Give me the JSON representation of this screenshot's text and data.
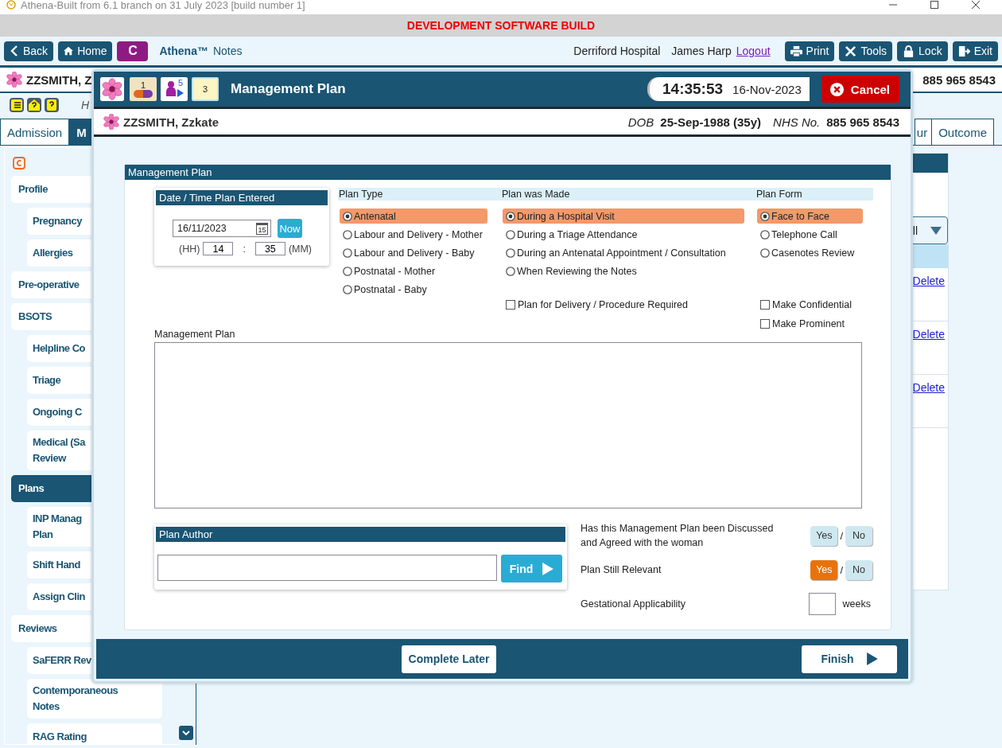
{
  "title_bar": {
    "title": "Athena-Built from 6.1 branch on 31 July 2023 [build number 1]"
  },
  "banner": "DEVELOPMENT SOFTWARE BUILD",
  "toolbar": {
    "left_buttons": [
      {
        "label": "Back"
      },
      {
        "label": "Home"
      }
    ],
    "c_button": "C",
    "app_name": "Athena™",
    "app_suffix": "Notes",
    "hospital": "Derriford Hospital",
    "user": "James Harp",
    "logout": "Logout",
    "right_buttons": [
      {
        "label": "Print"
      },
      {
        "label": "Tools"
      },
      {
        "label": "Lock"
      },
      {
        "label": "Exit"
      }
    ]
  },
  "patient_bar": {
    "name": "ZZSMITH, Z",
    "nhs": "885 965 8543"
  },
  "help_row": {
    "text": "H"
  },
  "tabs": [
    {
      "label": "Admission",
      "selected": false
    },
    {
      "label": "M",
      "selected": true
    },
    {
      "label": "ur",
      "selected": false
    },
    {
      "label": "Outcome",
      "selected": false
    }
  ],
  "sidebar": {
    "items": [
      {
        "label": "Profile",
        "selected": false,
        "children": [
          {
            "label": "Pregnancy",
            "selected": false
          },
          {
            "label": "Allergies",
            "selected": false
          }
        ]
      },
      {
        "label": "Pre-operative",
        "selected": false
      },
      {
        "label": "BSOTS",
        "selected": false,
        "children": [
          {
            "label": "Helpline Co",
            "selected": false
          },
          {
            "label": "Triage",
            "selected": false
          },
          {
            "label": "Ongoing C",
            "selected": false
          },
          {
            "label": "Medical (Sa\nReview",
            "selected": false
          }
        ]
      },
      {
        "label": "Plans",
        "selected": true,
        "children": [
          {
            "label": "INP Manag\nPlan",
            "selected": false
          },
          {
            "label": "Shift Hand",
            "selected": false
          },
          {
            "label": "Assign Clin",
            "selected": false
          }
        ]
      },
      {
        "label": "Reviews",
        "selected": false,
        "children": [
          {
            "label": "SaFERR Rev",
            "selected": false
          },
          {
            "label": "Contemporaneous\nNotes",
            "selected": false
          },
          {
            "label": "RAG Rating",
            "selected": false
          }
        ]
      }
    ]
  },
  "right_panel": {
    "filter": "ll",
    "links": [
      "Delete",
      "Delete",
      "Delete"
    ]
  },
  "modal": {
    "header_icons": [
      {
        "kind": "flower"
      },
      {
        "kind": "pill",
        "badge": "1"
      },
      {
        "kind": "person",
        "badge": "5"
      },
      {
        "kind": "notes",
        "badge": "3"
      }
    ],
    "title": "Management Plan",
    "time": "14:35:53",
    "date": "16-Nov-2023",
    "cancel": "Cancel",
    "patient": {
      "name": "ZZSMITH, Zzkate",
      "dob_label": "DOB",
      "dob": "25-Sep-1988 (35y)",
      "nhs_label": "NHS No.",
      "nhs": "885 965 8543"
    },
    "panel_title": "Management Plan",
    "date_card": {
      "title": "Date / Time Plan Entered",
      "date": "16/11/2023",
      "calendar_day": "15",
      "now": "Now",
      "hh_label": "(HH)",
      "hour": "14",
      "sep": ":",
      "minute": "35",
      "mm_label": "(MM)"
    },
    "groups": [
      {
        "title": "Plan Type",
        "options": [
          {
            "label": "Antenatal",
            "selected": true
          },
          {
            "label": "Labour and Delivery - Mother",
            "selected": false
          },
          {
            "label": "Labour and Delivery - Baby",
            "selected": false
          },
          {
            "label": "Postnatal - Mother",
            "selected": false
          },
          {
            "label": "Postnatal - Baby",
            "selected": false
          }
        ]
      },
      {
        "title": "Plan was Made",
        "options": [
          {
            "label": "During a Hospital Visit",
            "selected": true
          },
          {
            "label": "During a Triage Attendance",
            "selected": false
          },
          {
            "label": "During an Antenatal Appointment / Consultation",
            "selected": false
          },
          {
            "label": "When Reviewing the Notes",
            "selected": false
          }
        ],
        "checkboxes": [
          {
            "label": "Plan for Delivery / Procedure Required",
            "checked": false
          }
        ]
      },
      {
        "title": "Plan Form",
        "options": [
          {
            "label": "Face to Face",
            "selected": true
          },
          {
            "label": "Telephone Call",
            "selected": false
          },
          {
            "label": "Casenotes Review",
            "selected": false
          }
        ],
        "checkboxes": [
          {
            "label": "Make Confidential",
            "checked": false
          },
          {
            "label": "Make Prominent",
            "checked": false
          }
        ]
      }
    ],
    "notes": {
      "label": "Management Plan"
    },
    "author": {
      "title": "Plan Author",
      "find": "Find"
    },
    "questions": [
      {
        "kind": "yesno",
        "label": "Has this Management Plan been Discussed and Agreed with the woman",
        "sep": "/",
        "options": [
          {
            "label": "Yes",
            "selected": false
          },
          {
            "label": "No",
            "selected": false
          }
        ]
      },
      {
        "kind": "yesno",
        "label": "Plan Still Relevant",
        "sep": "/",
        "options": [
          {
            "label": "Yes",
            "selected": true
          },
          {
            "label": "No",
            "selected": false
          }
        ]
      },
      {
        "kind": "number",
        "label": "Gestational Applicability",
        "unit": "weeks"
      }
    ],
    "footer": {
      "complete_later": "Complete Later",
      "finish": "Finish"
    }
  }
}
